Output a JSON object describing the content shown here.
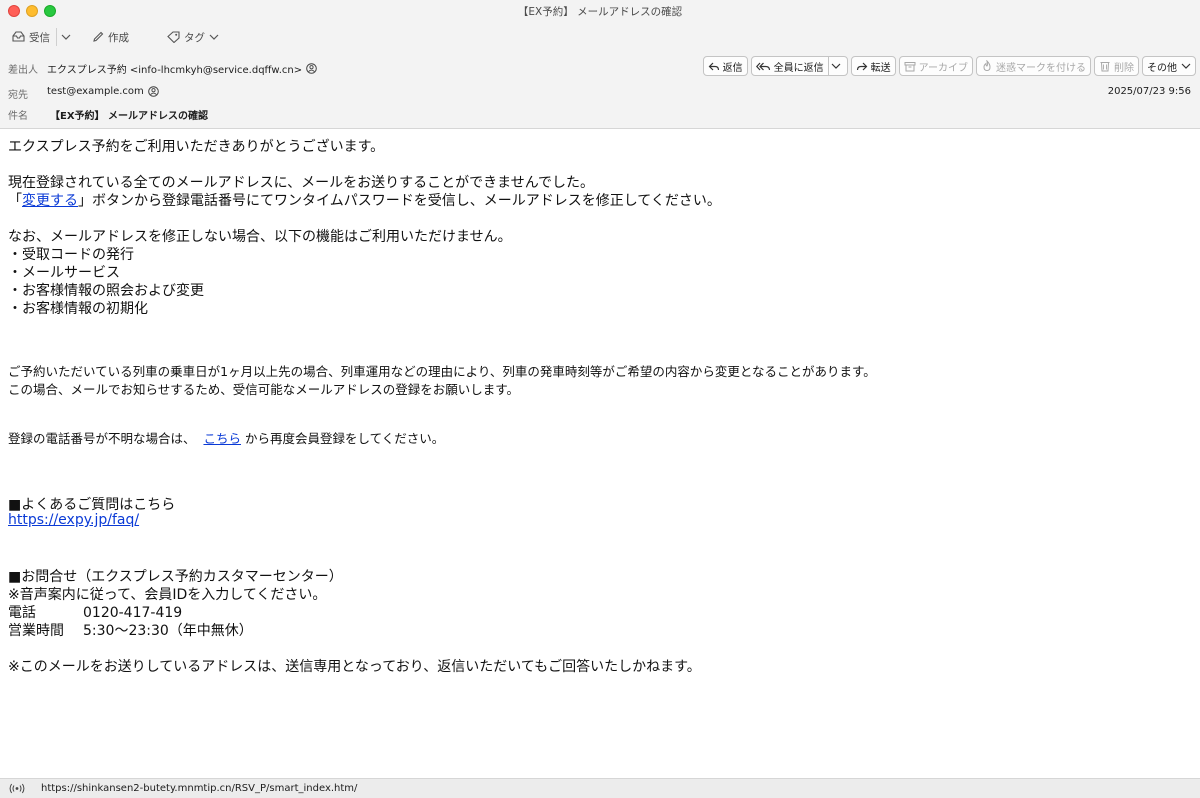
{
  "window": {
    "title": "【EX予約】 メールアドレスの確認"
  },
  "toolbar": {
    "receive": "受信",
    "compose": "作成",
    "tag": "タグ"
  },
  "header": {
    "from_label": "差出人",
    "from_value": "エクスプレス予約 <info-lhcmkyh@service.dqffw.cn>",
    "to_label": "宛先",
    "to_value": "test@example.com",
    "subject_label": "件名",
    "subject_value": "【EX予約】 メールアドレスの確認",
    "date": "2025/07/23 9:56"
  },
  "actions": {
    "reply": "返信",
    "reply_all": "全員に返信",
    "forward": "転送",
    "archive": "アーカイブ",
    "junk": "迷惑マークを付ける",
    "delete": "削除",
    "other": "その他"
  },
  "body": {
    "line1": "エクスプレス予約をご利用いただきありがとうございます。",
    "line2": "現在登録されている全てのメールアドレスに、メールをお送りすることができませんでした。",
    "line3_pre": "「",
    "line3_link": "変更する",
    "line3_post": "」ボタンから登録電話番号にてワンタイムパスワードを受信し、メールアドレスを修正してください。",
    "line4": "なお、メールアドレスを修正しない場合、以下の機能はご利用いただけません。",
    "bullets": [
      "・受取コードの発行",
      "・メールサービス",
      "・お客様情報の照会および変更",
      "・お客様情報の初期化"
    ],
    "note1": "ご予約いただいている列車の乗車日が1ヶ月以上先の場合、列車運用などの理由により、列車の発車時刻等がご希望の内容から変更となることがあります。",
    "note2": "この場合、メールでお知らせするため、受信可能なメールアドレスの登録をお願いします。",
    "phone_pre": "登録の電話番号が不明な場合は、",
    "phone_link": "こちら",
    "phone_post": "から再度会員登録をしてください。",
    "faq_heading": "■よくあるご質問はこちら",
    "faq_link": "https://expy.jp/faq/",
    "contact_heading": "■お問合せ（エクスプレス予約カスタマーセンター）",
    "contact_note": "※音声案内に従って、会員IDを入力してください。",
    "phone_label": "電話",
    "phone_value": "0120-417-419",
    "hours_label": "営業時間",
    "hours_value": "5:30〜23:30（年中無休）",
    "footer": "※このメールをお送りしているアドレスは、送信専用となっており、返信いただいてもご回答いたしかねます。"
  },
  "status": {
    "url": "https://shinkansen2-butety.mnmtip.cn/RSV_P/smart_index.htm/"
  }
}
